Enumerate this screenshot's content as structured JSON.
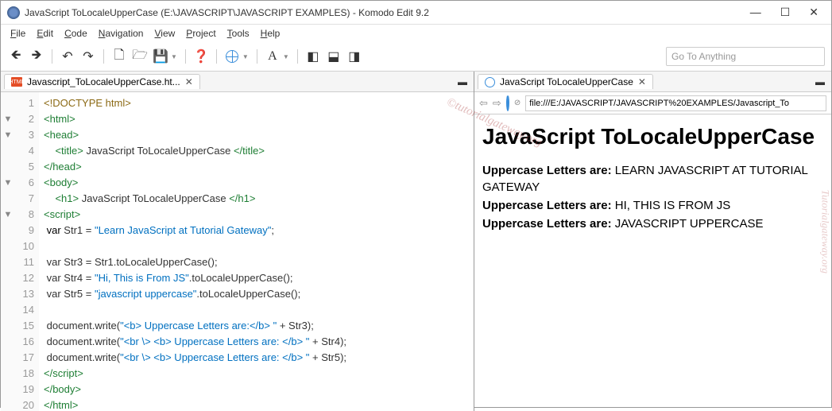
{
  "window": {
    "title": "JavaScript ToLocaleUpperCase (E:\\JAVASCRIPT\\JAVASCRIPT EXAMPLES) - Komodo Edit 9.2"
  },
  "menus": [
    "File",
    "Edit",
    "Code",
    "Navigation",
    "View",
    "Project",
    "Tools",
    "Help"
  ],
  "goto_placeholder": "Go To Anything",
  "editor_tab": {
    "label": "Javascript_ToLocaleUpperCase.ht...",
    "icon_text": "HTML"
  },
  "preview_tab": {
    "label": "JavaScript ToLocaleUpperCase"
  },
  "address_bar": "file:///E:/JAVASCRIPT/JAVASCRIPT%20EXAMPLES/Javascript_To",
  "code": {
    "line1": "<!DOCTYPE html>",
    "line2_open": "<html>",
    "line3_open": "<head>",
    "line4_title_open": "<title>",
    "line4_text": " JavaScript ToLocaleUpperCase ",
    "line4_title_close": "</title>",
    "line5": "</head>",
    "line6_open": "<body>",
    "line7_h1_open": "<h1>",
    "line7_text": " JavaScript ToLocaleUpperCase ",
    "line7_h1_close": "</h1>",
    "line8": "<script>",
    "line9_var": " var",
    "line9_name": " Str1 = ",
    "line9_str": "\"Learn JavaScript at Tutorial Gateway\"",
    "line9_end": ";",
    "line10": "",
    "line11": " var Str3 = Str1.toLocaleUpperCase();",
    "line12_a": " var Str4 = ",
    "line12_str": "\"Hi, This is From JS\"",
    "line12_b": ".toLocaleUpperCase();",
    "line13_a": " var Str5 = ",
    "line13_str": "\"javascript uppercase\"",
    "line13_b": ".toLocaleUpperCase();",
    "line14": "",
    "line15_a": " document.write(",
    "line15_str": "\"<b> Uppercase Letters are:</b> \"",
    "line15_b": " + Str3);",
    "line16_a": " document.write(",
    "line16_str": "\"<br \\> <b> Uppercase Letters are: </b> \"",
    "line16_b": " + Str4);",
    "line17_a": " document.write(",
    "line17_str": "\"<br \\> <b> Uppercase Letters are: </b> \"",
    "line17_b": " + Str5);",
    "line18": "</script>",
    "line19": "</body>",
    "line20": "</html>"
  },
  "line_numbers": [
    "1",
    "2",
    "3",
    "4",
    "5",
    "6",
    "7",
    "8",
    "9",
    "10",
    "11",
    "12",
    "13",
    "14",
    "15",
    "16",
    "17",
    "18",
    "19",
    "20"
  ],
  "fold_rows": {
    "2": "▼",
    "3": "▼",
    "6": "▼",
    "8": "▼"
  },
  "preview": {
    "heading": "JavaScript ToLocaleUpperCase",
    "lines": [
      {
        "bold": "Uppercase Letters are:",
        "text": " LEARN JAVASCRIPT AT TUTORIAL GATEWAY"
      },
      {
        "bold": "Uppercase Letters are:",
        "text": " HI, THIS IS FROM JS"
      },
      {
        "bold": "Uppercase Letters are:",
        "text": " JAVASCRIPT UPPERCASE"
      }
    ]
  },
  "watermark": "©tutorialgateway.org",
  "watermark_side": "Tutorialgateway.org"
}
